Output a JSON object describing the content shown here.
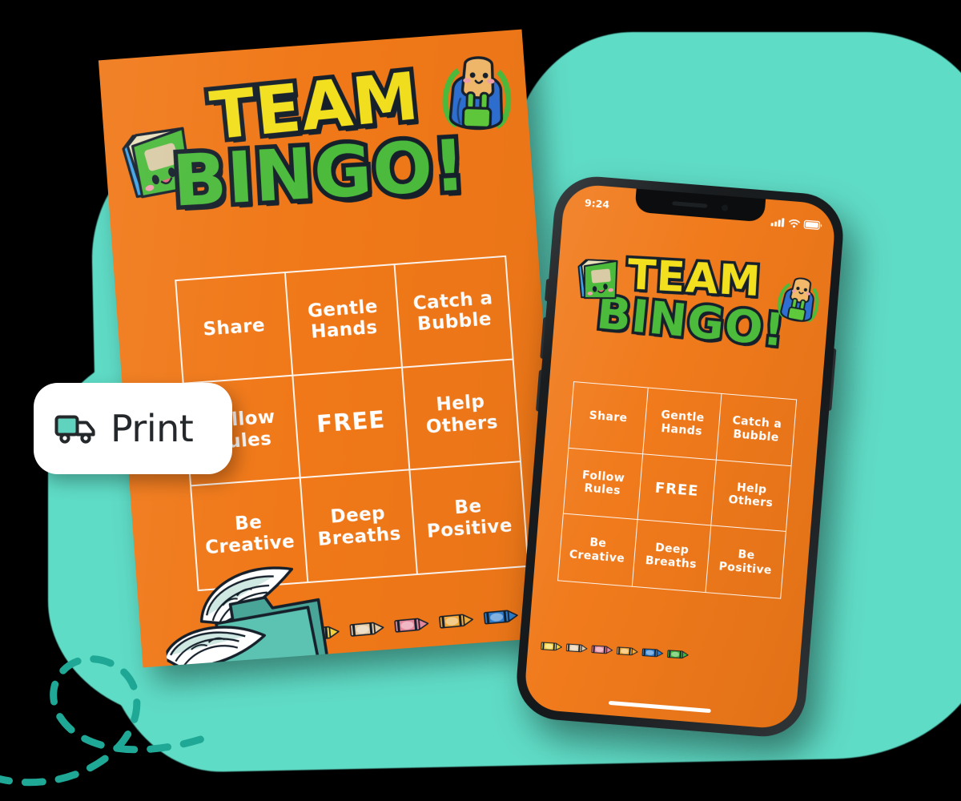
{
  "poster": {
    "title_line1": "TEAM",
    "title_line2": "BINGO!",
    "background_color": "#F07818",
    "title_color_1": "#F2DF1E",
    "title_color_2": "#4CBB3C",
    "outline_color": "#16202B",
    "stickers": [
      {
        "name": "book-sticker",
        "label": "kawaii green book"
      },
      {
        "name": "backpack-sticker",
        "label": "kawaii blue backpack with bear"
      }
    ],
    "decorations": [
      {
        "name": "winged-folder",
        "label": "teal folder with wings"
      },
      {
        "name": "crayon-strip",
        "label": "row of colored crayons"
      }
    ]
  },
  "bingo": {
    "columns": 3,
    "rows": 3,
    "cells": [
      "Share",
      "Gentle Hands",
      "Catch a Bubble",
      "Follow Rules",
      "FREE",
      "Help Others",
      "Be Creative",
      "Deep Breaths",
      "Be Positive"
    ],
    "free_index": 4,
    "border_color": "#FFFFFF",
    "text_color": "#FFFFFF"
  },
  "print_button": {
    "label": "Print",
    "icon": "delivery-truck-icon",
    "icon_color": "#5FD3BE",
    "icon_outline": "#25282B",
    "background": "#FFFFFF",
    "text_color": "#25282B"
  },
  "phone": {
    "status": {
      "time": "9:24",
      "cellular": "cellular-signal-icon",
      "wifi": "wifi-icon",
      "battery": "battery-icon"
    },
    "frame_color": "#1a1d1f",
    "screen_background": "#F07818",
    "home_indicator": "home-indicator-bar"
  },
  "background": {
    "canvas_color": "#000000",
    "blob_color": "#5FDCC6",
    "swirl_color": "#1FA896",
    "swirl": "dashed-loop-path"
  },
  "crayons": [
    {
      "name": "crayon-yellow",
      "color": "#F5D23A"
    },
    {
      "name": "crayon-tan",
      "color": "#E6CBA4"
    },
    {
      "name": "crayon-pink",
      "color": "#E8899E"
    },
    {
      "name": "crayon-orange",
      "color": "#F5AE3C"
    },
    {
      "name": "crayon-blue",
      "color": "#2E7FD1"
    },
    {
      "name": "crayon-green",
      "color": "#43B83C"
    }
  ]
}
